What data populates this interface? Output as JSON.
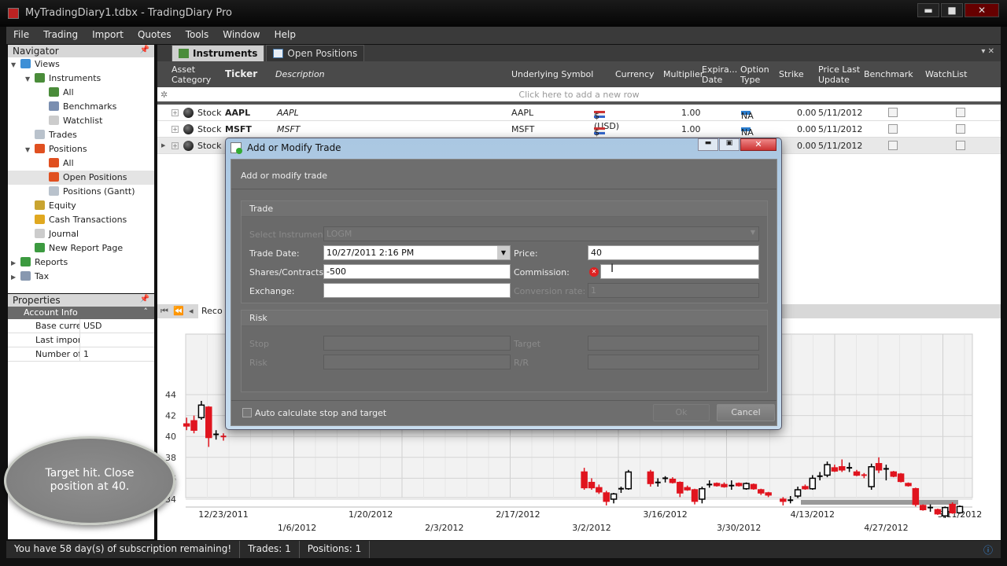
{
  "window": {
    "title": "MyTradingDiary1.tdbx - TradingDiary Pro",
    "min": "▬",
    "max": "■",
    "close": "✕"
  },
  "menu": [
    "File",
    "Trading",
    "Import",
    "Quotes",
    "Tools",
    "Window",
    "Help"
  ],
  "navigator": {
    "title": "Navigator",
    "items": [
      {
        "label": "Views",
        "depth": 0,
        "arrow": "v",
        "icon": "views-icon",
        "color": "#3d8fd6"
      },
      {
        "label": "Instruments",
        "depth": 1,
        "arrow": "v",
        "icon": "instruments-icon",
        "color": "#4a8c3a"
      },
      {
        "label": "All",
        "depth": 2,
        "arrow": "",
        "icon": "instruments-icon",
        "color": "#4a8c3a"
      },
      {
        "label": "Benchmarks",
        "depth": 2,
        "arrow": "",
        "icon": "globe-icon",
        "color": "#7a8eb0"
      },
      {
        "label": "Watchlist",
        "depth": 2,
        "arrow": "",
        "icon": "document-chart-icon",
        "color": "#ccc"
      },
      {
        "label": "Trades",
        "depth": 1,
        "arrow": "",
        "icon": "grid-icon",
        "color": "#b9c2cc"
      },
      {
        "label": "Positions",
        "depth": 1,
        "arrow": "v",
        "icon": "positions-icon",
        "color": "#e05020"
      },
      {
        "label": "All",
        "depth": 2,
        "arrow": "",
        "icon": "positions-icon",
        "color": "#e05020"
      },
      {
        "label": "Open Positions",
        "depth": 2,
        "arrow": "",
        "icon": "positions-icon",
        "color": "#e05020",
        "selected": true
      },
      {
        "label": "Positions (Gantt)",
        "depth": 2,
        "arrow": "",
        "icon": "gantt-icon",
        "color": "#b9c2cc"
      },
      {
        "label": "Equity",
        "depth": 1,
        "arrow": "",
        "icon": "money-bag-icon",
        "color": "#c9a430"
      },
      {
        "label": "Cash Transactions",
        "depth": 1,
        "arrow": "",
        "icon": "coin-icon",
        "color": "#e0a820"
      },
      {
        "label": "Journal",
        "depth": 1,
        "arrow": "",
        "icon": "journal-icon",
        "color": "#ccc"
      },
      {
        "label": "New Report Page",
        "depth": 1,
        "arrow": "",
        "icon": "report-icon",
        "color": "#3c9a40"
      },
      {
        "label": "Reports",
        "depth": 0,
        "arrow": ">",
        "icon": "reports-icon",
        "color": "#3c9a40"
      },
      {
        "label": "Tax",
        "depth": 0,
        "arrow": ">",
        "icon": "tax-icon",
        "color": "#8898b0"
      }
    ]
  },
  "properties": {
    "title": "Properties",
    "group": "Account Info",
    "rows": [
      {
        "key": "Base currer",
        "value": "USD"
      },
      {
        "key": "Last import",
        "value": ""
      },
      {
        "key": "Number of t",
        "value": "1"
      }
    ]
  },
  "tabs": [
    {
      "label": "Instruments",
      "active": true
    },
    {
      "label": "Open Positions",
      "active": false
    }
  ],
  "grid": {
    "columns": [
      "Asset Category",
      "Ticker",
      "Description",
      "Underlying Symbol",
      "Currency",
      "Multiplier",
      "Expira... Date",
      "Option Type",
      "Strike",
      "Price Last Update",
      "Benchmark",
      "WatchList"
    ],
    "new_row": "Click here to add a new row",
    "rows": [
      {
        "category": "Stock",
        "ticker": "AAPL",
        "description": "AAPL",
        "underlying": "AAPL",
        "currency": "$ (USD)",
        "multiplier": "1.00",
        "option_type": "NA",
        "strike": "0.00",
        "updated": "5/11/2012",
        "benchmark": false,
        "watchlist": false
      },
      {
        "category": "Stock",
        "ticker": "MSFT",
        "description": "MSFT",
        "underlying": "MSFT",
        "currency": "$ (USD)",
        "multiplier": "1.00",
        "option_type": "NA",
        "strike": "0.00",
        "updated": "5/11/2012",
        "benchmark": false,
        "watchlist": false
      },
      {
        "category": "Stock",
        "ticker": "",
        "description": "",
        "underlying": "",
        "currency": "",
        "multiplier": "",
        "option_type": "",
        "strike": "0.00",
        "updated": "5/11/2012",
        "benchmark": false,
        "watchlist": false,
        "current": true
      }
    ]
  },
  "pager": {
    "label": "Reco"
  },
  "chart_data": {
    "type": "candlestick",
    "ylim": [
      31,
      45
    ],
    "yticks": [
      34,
      36,
      38,
      40,
      42,
      44
    ],
    "xticks_row1": [
      "12/23/2011",
      "1/20/2012",
      "2/17/2012",
      "3/16/2012",
      "4/13/2012",
      "5/11/2012"
    ],
    "xticks_row2": [
      "1/6/2012",
      "2/3/2012",
      "3/2/2012",
      "3/30/2012",
      "4/27/2012"
    ],
    "up_color": "#ffffff",
    "down_color": "#e0141e",
    "candles": [
      [
        "2011-12-16",
        41.2,
        41.8,
        40.6,
        41.0
      ],
      [
        "2011-12-19",
        41.5,
        42,
        40.3,
        40.6
      ],
      [
        "2011-12-20",
        41.8,
        43.4,
        41.6,
        43.0
      ],
      [
        "2011-12-21",
        42.8,
        42.9,
        39,
        39.9
      ],
      [
        "2011-12-22",
        40.1,
        40.6,
        39.7,
        40.2
      ],
      [
        "2011-12-23",
        40,
        40.3,
        39.6,
        39.9
      ],
      [
        "2012-03-01",
        36.6,
        37,
        34.9,
        35.1
      ],
      [
        "2012-03-02",
        35.6,
        36,
        34.9,
        35.1
      ],
      [
        "2012-03-05",
        35.1,
        35.4,
        34.5,
        34.7
      ],
      [
        "2012-03-06",
        34.6,
        34.8,
        33.4,
        33.8
      ],
      [
        "2012-03-07",
        34.0,
        34.6,
        33.6,
        34.5
      ],
      [
        "2012-03-08",
        34.9,
        35.2,
        34.6,
        35.0
      ],
      [
        "2012-03-09",
        35.0,
        36.8,
        34.9,
        36.6
      ],
      [
        "2012-03-14",
        36.6,
        36.8,
        35.2,
        35.5
      ],
      [
        "2012-03-15",
        35.6,
        36.0,
        35.2,
        35.6
      ],
      [
        "2012-03-16",
        35.9,
        36.2,
        35.6,
        36.0
      ],
      [
        "2012-03-19",
        35.9,
        36.1,
        35.5,
        35.6
      ],
      [
        "2012-03-20",
        35.6,
        35.7,
        34.2,
        34.6
      ],
      [
        "2012-03-21",
        35.1,
        35.3,
        34.8,
        34.9
      ],
      [
        "2012-03-22",
        34.9,
        35.0,
        33.5,
        33.8
      ],
      [
        "2012-03-23",
        34.0,
        35.2,
        33.6,
        35.0
      ],
      [
        "2012-03-26",
        35.4,
        35.8,
        35.1,
        35.4
      ],
      [
        "2012-03-27",
        35.5,
        35.6,
        35.2,
        35.3
      ],
      [
        "2012-03-28",
        35.4,
        35.6,
        35.1,
        35.2
      ],
      [
        "2012-03-29",
        35.3,
        35.8,
        34.9,
        35.3
      ],
      [
        "2012-03-30",
        35.5,
        35.6,
        35.2,
        35.3
      ],
      [
        "2012-04-02",
        35.0,
        35.6,
        34.9,
        35.5
      ],
      [
        "2012-04-03",
        35.4,
        35.5,
        34.9,
        35.0
      ],
      [
        "2012-04-04",
        34.9,
        35.0,
        34.4,
        34.6
      ],
      [
        "2012-04-05",
        34.6,
        34.7,
        34.2,
        34.4
      ],
      [
        "2012-04-09",
        34.0,
        34.2,
        33.4,
        33.8
      ],
      [
        "2012-04-10",
        33.9,
        34.3,
        33.6,
        33.9
      ],
      [
        "2012-04-11",
        34.3,
        35.2,
        34.1,
        34.9
      ],
      [
        "2012-04-12",
        35.2,
        35.4,
        34.9,
        35.0
      ],
      [
        "2012-04-13",
        35.0,
        36.3,
        34.9,
        36.0
      ],
      [
        "2012-04-16",
        36.1,
        36.6,
        35.8,
        36.2
      ],
      [
        "2012-04-17",
        36.3,
        37.6,
        36.1,
        37.3
      ],
      [
        "2012-04-18",
        37.0,
        37.3,
        36.6,
        36.7
      ],
      [
        "2012-04-19",
        37.1,
        37.8,
        36.6,
        36.8
      ],
      [
        "2012-04-20",
        37.0,
        37.5,
        36.6,
        37.0
      ],
      [
        "2012-04-23",
        36.6,
        36.8,
        36.2,
        36.3
      ],
      [
        "2012-04-24",
        36.3,
        36.5,
        36.0,
        36.2
      ],
      [
        "2012-04-25",
        35.2,
        37.4,
        34.9,
        37.1
      ],
      [
        "2012-04-26",
        37.4,
        38.0,
        36.5,
        36.8
      ],
      [
        "2012-04-27",
        36.9,
        37.3,
        35.8,
        36.9
      ],
      [
        "2012-04-30",
        36.6,
        36.7,
        36.1,
        36.2
      ],
      [
        "2012-05-01",
        36.4,
        36.5,
        35.6,
        35.7
      ],
      [
        "2012-05-02",
        35.5,
        35.6,
        35.2,
        35.3
      ],
      [
        "2012-05-03",
        35.0,
        35.1,
        33.3,
        33.5
      ],
      [
        "2012-05-04",
        33.4,
        33.5,
        32.9,
        33.0
      ],
      [
        "2012-05-07",
        33.2,
        33.5,
        32.8,
        33.2
      ],
      [
        "2012-05-08",
        33.0,
        33.1,
        32.5,
        32.6
      ],
      [
        "2012-05-09",
        32.4,
        33.3,
        32.2,
        33.2
      ],
      [
        "2012-05-10",
        33.5,
        33.7,
        32.6,
        32.7
      ],
      [
        "2012-05-11",
        32.7,
        33.4,
        32.6,
        33.3
      ]
    ]
  },
  "status": {
    "subscription": "You have 58 day(s) of subscription remaining!",
    "trades": "Trades: 1",
    "positions": "Positions: 1"
  },
  "dialog": {
    "title": "Add or Modify Trade",
    "header": "Add or modify trade",
    "trade_section": "Trade",
    "select_instrument_label": "Select Instrument:",
    "select_instrument_value": "LOGM",
    "trade_date_label": "Trade Date:",
    "trade_date_value": "10/27/2011 2:16 PM",
    "price_label": "Price:",
    "price_value": "40",
    "shares_label": "Shares/Contracts:",
    "shares_value": "-500",
    "commission_label": "Commission:",
    "commission_value": "",
    "exchange_label": "Exchange:",
    "exchange_value": "",
    "conversion_label": "Conversion rate:",
    "conversion_value": "1",
    "risk_section": "Risk",
    "stop_label": "Stop",
    "target_label": "Target",
    "risk_label": "Risk",
    "rr_label": "R/R",
    "auto_calc_label": "Auto calculate stop and target",
    "auto_calc_checked": false,
    "ok_label": "Ok",
    "cancel_label": "Cancel"
  },
  "callout": {
    "text": "Target hit. Close position at 40."
  }
}
